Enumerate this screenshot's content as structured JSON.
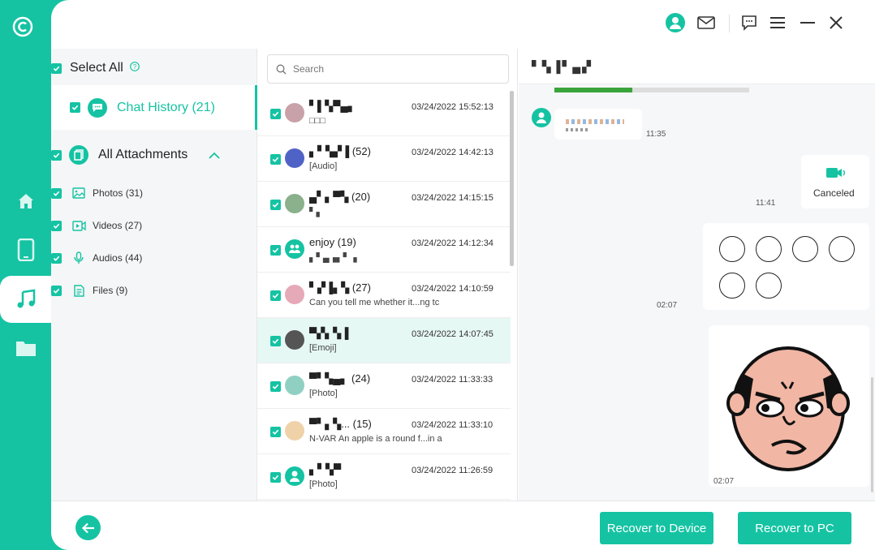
{
  "colors": {
    "accent": "#15c3a3",
    "panel": "#ffffff",
    "subtle_bg": "#f5f6f7"
  },
  "tree": {
    "select_all": "Select All",
    "chat_history": "Chat History (21)",
    "all_attachments": "All Attachments",
    "subitems": [
      {
        "label": "Photos (31)",
        "icon": "image-icon"
      },
      {
        "label": "Videos (27)",
        "icon": "video-icon"
      },
      {
        "label": "Audios (44)",
        "icon": "microphone-icon"
      },
      {
        "label": "Files (9)",
        "icon": "file-icon"
      }
    ]
  },
  "search": {
    "placeholder": "Search"
  },
  "chats": [
    {
      "name": "▘▌▚▀▄▖",
      "date": "03/24/2022 15:52:13",
      "preview": "□□□",
      "avatar_color": "#c9a1a9"
    },
    {
      "name": "▖▘▚▞▐ (52)",
      "date": "03/24/2022 14:42:13",
      "preview": "[Audio]",
      "avatar_color": "#4f63c7"
    },
    {
      "name": "▄▘▖▀▚ (20)",
      "date": "03/24/2022 14:15:15",
      "preview": "▘▖",
      "avatar_color": "#8bb08c"
    },
    {
      "name": "enjoy  (19)",
      "date": "03/24/2022 14:12:34",
      "preview": "▖▘▄▗▖▘▗",
      "avatar_color": "#15c3a3"
    },
    {
      "name": "▘▞▐▖▚ (27)",
      "date": "03/24/2022 14:10:59",
      "preview": "Can you tell me whether it...ng tc",
      "avatar_color": "#e6a9b7"
    },
    {
      "name": "▀▞▖▚▐",
      "date": "03/24/2022 14:07:45",
      "preview": "[Emoji]",
      "avatar_color": "#555555"
    },
    {
      "name": "▀▘▚▄▖ (24)",
      "date": "03/24/2022 11:33:33",
      "preview": "[Photo]",
      "avatar_color": "#8fd0c2"
    },
    {
      "name": "▀▘▖▚... (15)",
      "date": "03/24/2022 11:33:10",
      "preview": "N-VAR An apple is a round f...in a",
      "avatar_color": "#f0d2a8"
    },
    {
      "name": "▖▘▚▀",
      "date": "03/24/2022 11:26:59",
      "preview": "[Photo]",
      "avatar_color": "#15c3a3"
    }
  ],
  "conversation": {
    "title": "▘▚▐▘▄▞",
    "messages": [
      {
        "time": "11:35"
      },
      {
        "time": "11:41",
        "status": "Canceled"
      },
      {
        "time": "02:07"
      },
      {
        "time": "02:07"
      }
    ]
  },
  "buttons": {
    "recover_device": "Recover to Device",
    "recover_pc": "Recover to PC"
  }
}
